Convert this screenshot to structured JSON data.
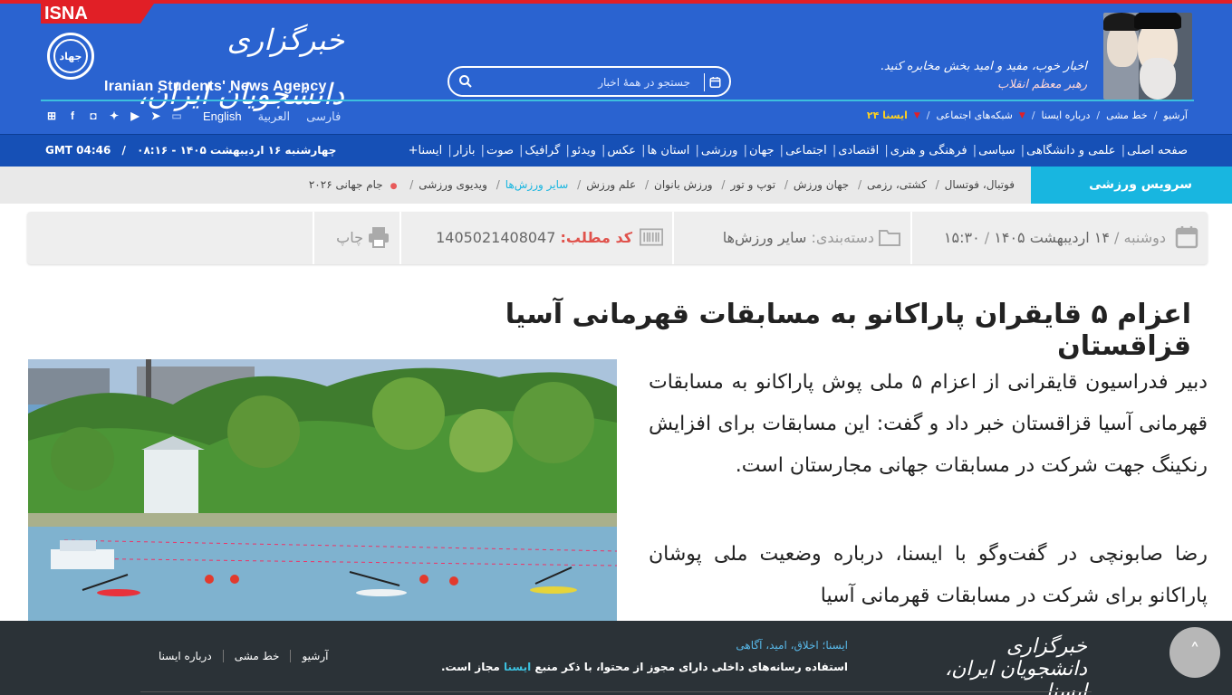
{
  "header": {
    "isna_tag": "ISNA",
    "logo_seal_text": "جهاد",
    "logo_fa": "خبرگزاری دانشجویان ایران، ایسنا",
    "logo_en": "Iranian Students' News Agency",
    "search_placeholder": "جستجو در همهٔ اخبار",
    "slogan_line1": "اخبار خوب، مفید و امید بخش مخابره کنید.",
    "slogan_line2": "رهبر معظم انقلاب",
    "languages": [
      "فارسی",
      "العربية",
      "English"
    ],
    "top_links": [
      "آرشیو",
      "خط مشی",
      "درباره ایسنا",
      "شبکه‌های اجتماعی",
      "ایسنا ۲۴"
    ],
    "social_icons": [
      "telegram-icon",
      "youtube-icon",
      "twitter-icon",
      "facebook-icon",
      "instagram-icon",
      "bale-icon",
      "tv-icon"
    ]
  },
  "nav": {
    "items": [
      "صفحه اصلی",
      "علمی و دانشگاهی",
      "سیاسی",
      "فرهنگی و هنری",
      "اقتصادی",
      "اجتماعی",
      "جهان",
      "ورزشی",
      "استان ها",
      "عکس",
      "ویدئو",
      "گرافیک",
      "صوت",
      "بازار",
      "ایسنا+"
    ],
    "datetime": "چهارشنبه ۱۶ اردیبهشت ۱۴۰۵ - ۰۸:۱۶",
    "gmt": "GMT 04:46"
  },
  "subnav": {
    "title": "سرویس ورزشی",
    "items": [
      "فوتبال، فوتسال",
      "کشتی، رزمی",
      "جهان ورزش",
      "توپ و تور",
      "ورزش بانوان",
      "علم ورزش",
      "سایر ورزش‌ها",
      "ویدیوی ورزشی",
      "جام جهانی ۲۰۲۶"
    ],
    "active_index": 6
  },
  "info": {
    "date_day": "دوشنبه",
    "date": "۱۴ اردیبهشت ۱۴۰۵",
    "time": "۱۵:۳۰",
    "category_label": "دسته‌بندی:",
    "category_value": "سایر ورزش‌ها",
    "code_label": "کد مطلب:",
    "code_value": "1405021408047",
    "print_label": "چاپ"
  },
  "article": {
    "title": "اعزام ۵ قایقران پاراکانو به مسابقات قهرمانی آسیا قزاقستان",
    "lead": "دبیر فدراسیون قایقرانی از اعزام ۵ ملی پوش پاراکانو به مسابقات قهرمانی آسیا قزاقستان خبر داد و گفت: این مسابقات برای افزایش رنکینگ جهت شرکت در مسابقات جهانی مجارستان است.",
    "p2": "رضا صابونچی در گفت‌وگو با ایسنا، درباره وضعیت ملی پوشان پاراکانو برای شرکت در مسابقات قهرمانی آسیا"
  },
  "footer": {
    "logo": "خبرگزاری دانشجویان ایران، ایسنا",
    "tagline": "ایسنا؛ اخلاق، امید، آگاهی",
    "copy_before": "استفاده رسانه‌های داخلی دارای مجوز از محتوا، با ذکر منبع ",
    "copy_highlight": "ایسنا",
    "copy_after": " مجاز است.",
    "links": [
      "آرشیو",
      "خط مشی",
      "درباره ایسنا"
    ],
    "scroll_top_symbol": "˄"
  }
}
